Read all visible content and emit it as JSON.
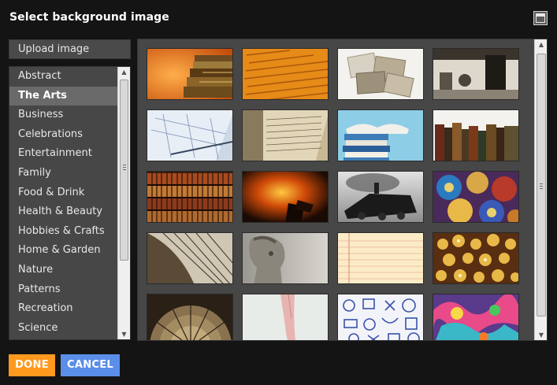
{
  "dialog": {
    "title": "Select background image",
    "upload_label": "Upload image",
    "done_label": "DONE",
    "cancel_label": "CANCEL",
    "maximize_icon": "maximize-icon"
  },
  "categories": {
    "selected": "The Arts",
    "items": [
      {
        "label": "Abstract"
      },
      {
        "label": "The Arts"
      },
      {
        "label": "Business"
      },
      {
        "label": "Celebrations"
      },
      {
        "label": "Entertainment"
      },
      {
        "label": "Family"
      },
      {
        "label": "Food & Drink"
      },
      {
        "label": "Health & Beauty"
      },
      {
        "label": "Hobbies & Crafts"
      },
      {
        "label": "Home & Garden"
      },
      {
        "label": "Nature"
      },
      {
        "label": "Patterns"
      },
      {
        "label": "Recreation"
      },
      {
        "label": "Science"
      }
    ]
  },
  "images": [
    {
      "subject": "books on orange background"
    },
    {
      "subject": "orange script text"
    },
    {
      "subject": "old photographs"
    },
    {
      "subject": "vintage workshop photo"
    },
    {
      "subject": "architectural blueprints"
    },
    {
      "subject": "open old book"
    },
    {
      "subject": "stack of books sky"
    },
    {
      "subject": "row of old books"
    },
    {
      "subject": "library bookshelf"
    },
    {
      "subject": "stage spotlight"
    },
    {
      "subject": "steam locomotive"
    },
    {
      "subject": "moroccan pottery"
    },
    {
      "subject": "harp strings"
    },
    {
      "subject": "david statue"
    },
    {
      "subject": "lined notepaper"
    },
    {
      "subject": "golden chandelier"
    },
    {
      "subject": "glass dome ceiling"
    },
    {
      "subject": "ballet shoes"
    },
    {
      "subject": "doodle pattern"
    },
    {
      "subject": "colorful graffiti"
    }
  ],
  "colors": {
    "background": "#141414",
    "panel": "#474747",
    "selected_row": "#6a6a6a",
    "done_button": "#ff9a1e",
    "cancel_button": "#5b8ee8"
  }
}
